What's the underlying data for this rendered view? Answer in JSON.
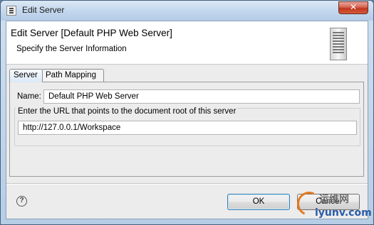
{
  "window": {
    "title": "Edit Server",
    "close_label": "✕"
  },
  "banner": {
    "heading": "Edit Server [Default PHP Web Server]",
    "subtitle": "Specify the Server Information",
    "icon": "server-icon"
  },
  "tabs": [
    {
      "label": "Server",
      "active": true
    },
    {
      "label": "Path Mapping",
      "active": false
    }
  ],
  "form": {
    "name_label": "Name:",
    "name_value": "Default PHP Web Server",
    "url_group_label": "Enter the URL that points to the document root of this server",
    "url_value": "http://127.0.0.1/Workspace"
  },
  "footer": {
    "help_glyph": "?",
    "ok_label": "OK",
    "cancel_label": "Cancel"
  },
  "watermark": {
    "top": "运维网",
    "bottom": "iyunv.com"
  }
}
